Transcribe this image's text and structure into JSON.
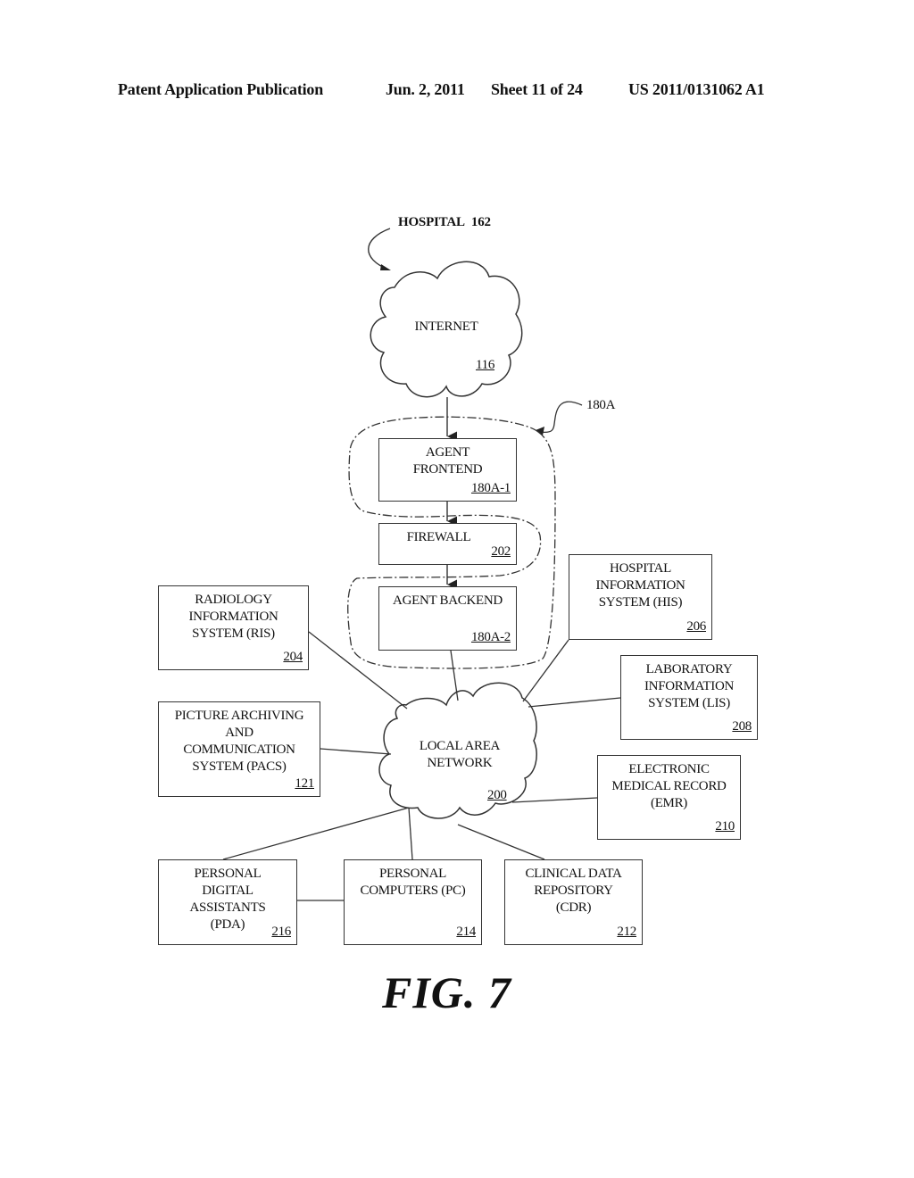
{
  "header": {
    "publication": "Patent Application Publication",
    "date": "Jun. 2, 2011",
    "sheet": "Sheet 11 of 24",
    "pub_number": "US 2011/0131062 A1"
  },
  "diagram": {
    "hospital_label": "HOSPITAL",
    "hospital_ref": "162",
    "internet": {
      "label": "INTERNET",
      "ref": "116"
    },
    "agent_group_ref": "180A",
    "agent_frontend": {
      "label": "AGENT\nFRONTEND",
      "ref": "180A-1"
    },
    "firewall": {
      "label": "FIREWALL",
      "ref": "202"
    },
    "agent_backend": {
      "label": "AGENT BACKEND",
      "ref": "180A-2"
    },
    "lan": {
      "label": "LOCAL AREA\nNETWORK",
      "ref": "200"
    },
    "ris": {
      "label": "RADIOLOGY\nINFORMATION\nSYSTEM (RIS)",
      "ref": "204"
    },
    "pacs": {
      "label": "PICTURE ARCHIVING\nAND\nCOMMUNICATION\nSYSTEM (PACS)",
      "ref": "121"
    },
    "his": {
      "label": "HOSPITAL\nINFORMATION\nSYSTEM (HIS)",
      "ref": "206"
    },
    "lis": {
      "label": "LABORATORY\nINFORMATION\nSYSTEM (LIS)",
      "ref": "208"
    },
    "emr": {
      "label": "ELECTRONIC\nMEDICAL RECORD\n(EMR)",
      "ref": "210"
    },
    "pda": {
      "label": "PERSONAL\nDIGITAL\nASSISTANTS\n(PDA)",
      "ref": "216"
    },
    "pc": {
      "label": "PERSONAL\nCOMPUTERS (PC)",
      "ref": "214"
    },
    "cdr": {
      "label": "CLINICAL DATA\nREPOSITORY\n(CDR)",
      "ref": "212"
    }
  },
  "figure_label": "FIG. 7"
}
